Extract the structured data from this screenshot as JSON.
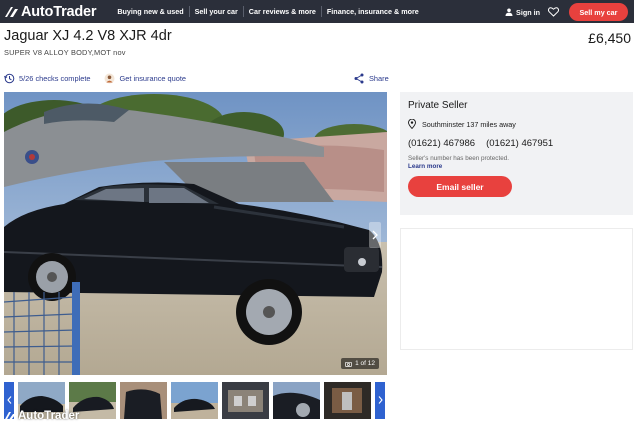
{
  "nav": {
    "logo_text": "AutoTrader",
    "links": [
      "Buying new & used",
      "Sell your car",
      "Car reviews & more",
      "Finance, insurance & more"
    ],
    "signin_label": "Sign in",
    "sell_button_label": "Sell my car"
  },
  "listing": {
    "title": "Jaguar XJ 4.2 V8 XJR 4dr",
    "price": "£6,450",
    "subtitle": "SUPER V8 ALLOY BODY,MOT nov",
    "checks_label": "5/26 checks complete",
    "insurance_label": "Get insurance quote",
    "share_label": "Share"
  },
  "gallery": {
    "image_count": "1 of 12",
    "thumbnail_count": 7
  },
  "seller": {
    "type": "Private Seller",
    "location": "Southminster 137 miles away",
    "phone_1": "(01621) 467986",
    "phone_2": "(01621) 467951",
    "protected_note": "Seller's number has been protected.",
    "learn_more": "Learn more",
    "email_button": "Email seller"
  },
  "watermark": "AutoTrader",
  "colors": {
    "nav_bg": "#2b2f3a",
    "accent_red": "#e8413e",
    "link_blue": "#2b3a8c",
    "panel_bg": "#f1f2f4"
  }
}
